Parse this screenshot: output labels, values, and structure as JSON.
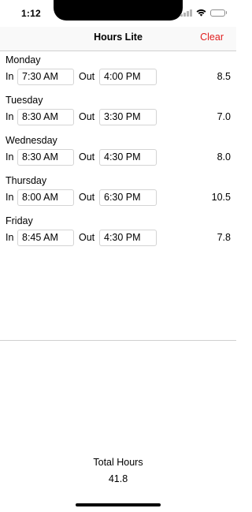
{
  "status_bar": {
    "time": "1:12"
  },
  "nav": {
    "title": "Hours Lite",
    "clear_label": "Clear"
  },
  "labels": {
    "in": "In",
    "out": "Out"
  },
  "days": [
    {
      "name": "Monday",
      "in": "7:30 AM",
      "out": "4:00 PM",
      "hours": "8.5"
    },
    {
      "name": "Tuesday",
      "in": "8:30 AM",
      "out": "3:30 PM",
      "hours": "7.0"
    },
    {
      "name": "Wednesday",
      "in": "8:30 AM",
      "out": "4:30 PM",
      "hours": "8.0"
    },
    {
      "name": "Thursday",
      "in": "8:00 AM",
      "out": "6:30 PM",
      "hours": "10.5"
    },
    {
      "name": "Friday",
      "in": "8:45 AM",
      "out": "4:30 PM",
      "hours": "7.8"
    }
  ],
  "total": {
    "label": "Total Hours",
    "value": "41.8"
  },
  "colors": {
    "accent": "#e01e1e",
    "separator": "#d0d0d0",
    "field_border": "#d4d4d4"
  }
}
